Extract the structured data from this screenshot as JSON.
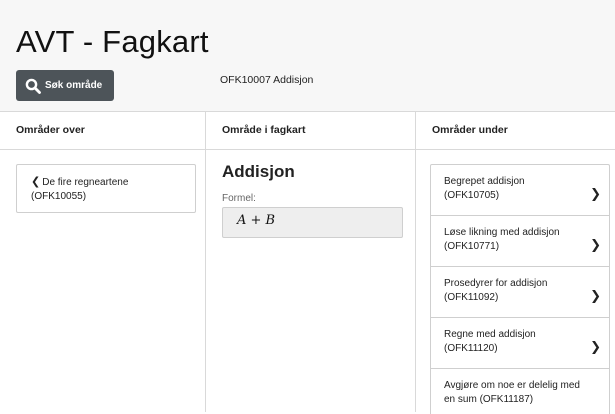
{
  "header": {
    "title": "AVT - Fagkart",
    "search_button_label": "Søk område",
    "current_area": "OFK10007 Addisjon"
  },
  "columns": {
    "over_label": "Områder over",
    "current_label": "Område i fagkart",
    "under_label": "Områder under"
  },
  "parent": {
    "chevron": "❮",
    "label": "De fire regneartene (OFK10055)"
  },
  "current": {
    "title": "Addisjon",
    "formula_label": "Formel:",
    "formula": "A + B"
  },
  "children": [
    {
      "label": "Begrepet addisjon (OFK10705)",
      "arrow": "❯"
    },
    {
      "label": "Løse likning med addisjon (OFK10771)",
      "arrow": "❯"
    },
    {
      "label": "Prosedyrer for addisjon (OFK11092)",
      "arrow": "❯"
    },
    {
      "label": "Regne med addisjon (OFK11120)",
      "arrow": "❯"
    },
    {
      "label": "Avgjøre om noe er delelig med en sum (OFK11187)",
      "arrow": ""
    }
  ],
  "icons": {
    "search": "search-icon"
  },
  "colors": {
    "header_bg": "#f7f7f7",
    "button_bg": "#4d5459",
    "border": "#cfcfcf"
  }
}
